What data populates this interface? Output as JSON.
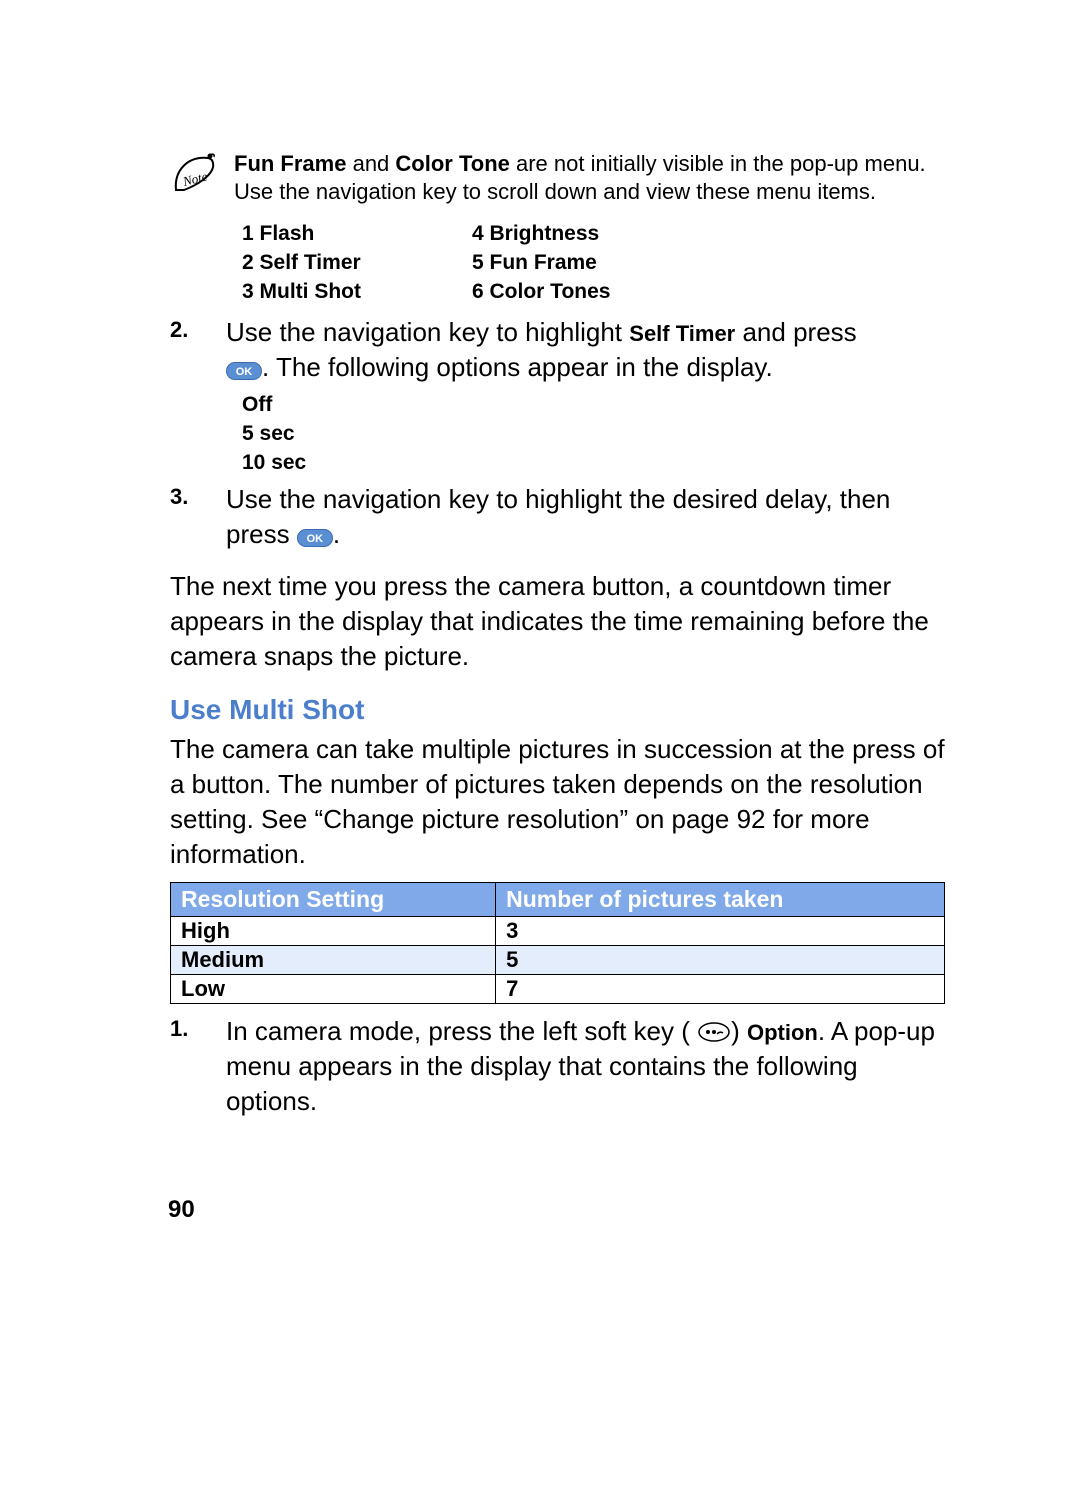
{
  "note": {
    "prefix_bold1": "Fun Frame",
    "mid1": " and ",
    "prefix_bold2": "Color Tone",
    "rest": " are not initially visible in the pop-up menu. Use the navigation key to scroll down and view these menu items."
  },
  "menu": {
    "c1r1": "1  Flash",
    "c2r1": "4  Brightness",
    "c1r2": "2  Self Timer",
    "c2r2": "5  Fun Frame",
    "c1r3": "3  Multi Shot",
    "c2r3": "6  Color Tones"
  },
  "step2": {
    "num": "2.",
    "part1": "Use the navigation key to highlight ",
    "bold1": "Self Timer",
    "part2": " and press ",
    "ok": "OK",
    "part3": ". The following options appear in the display."
  },
  "timer_options": {
    "l1": "Off",
    "l2": "5 sec",
    "l3": "10 sec"
  },
  "step3": {
    "num": "3.",
    "part1": "Use the navigation key to highlight the desired delay, then press ",
    "ok": "OK",
    "part2": "."
  },
  "para_after": "The next time you press the camera button, a countdown timer appears in the display that indicates the time remaining before the camera snaps the picture.",
  "heading": "Use Multi Shot",
  "para_multi": "The camera can take multiple pictures in succession at the press of a button. The number of pictures taken depends on the resolution setting. See “Change picture resolution” on page 92 for more information.",
  "chart_data": {
    "type": "table",
    "title": "",
    "columns": [
      "Resolution Setting",
      "Number of pictures taken"
    ],
    "rows": [
      {
        "resolution": "High",
        "count": "3"
      },
      {
        "resolution": "Medium",
        "count": "5"
      },
      {
        "resolution": "Low",
        "count": "7"
      }
    ]
  },
  "step1b": {
    "num": "1.",
    "part1": "In camera mode, press the left soft key (",
    "part2": ") ",
    "bold1": "Option",
    "part3": ". A pop-up menu appears in the display that contains the following options."
  },
  "page_number": "90"
}
